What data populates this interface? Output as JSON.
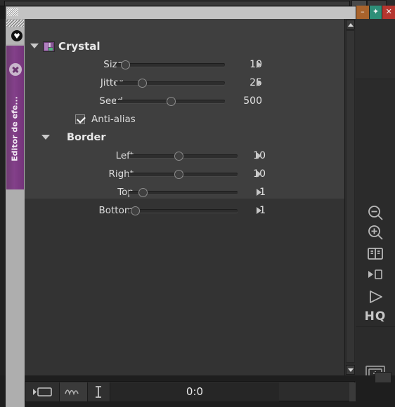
{
  "window": {
    "controls": [
      {
        "name": "minimize",
        "glyph": "–",
        "color": "#a9632c"
      },
      {
        "name": "maximize",
        "glyph": "✦",
        "color": "#2e8f78"
      },
      {
        "name": "close",
        "glyph": "✕",
        "color": "#b5362f"
      }
    ]
  },
  "left_rail": {
    "tab_label": "Editor de efe...",
    "tab_color": "#83408a",
    "close_icon": "close-circle-icon",
    "badge_icon": "shape-icon"
  },
  "effect": {
    "icon": "effect-thumbnail-icon",
    "title": "Crystal",
    "expanded": true,
    "parameters": [
      {
        "label": "Size",
        "value": "10",
        "knob_pct": 8,
        "has_keyframe_arrow": true
      },
      {
        "label": "Jitter",
        "value": "25",
        "knob_pct": 24,
        "has_keyframe_arrow": true
      },
      {
        "label": "Seed",
        "value": "500",
        "knob_pct": 50,
        "has_keyframe_arrow": false
      }
    ],
    "checkbox": {
      "label": "Anti-alias",
      "checked": true
    },
    "group": {
      "title": "Border",
      "expanded": true,
      "parameters": [
        {
          "label": "Left",
          "value": "10",
          "knob_pct": 46,
          "has_keyframe_arrow": true
        },
        {
          "label": "Right",
          "value": "10",
          "knob_pct": 46,
          "has_keyframe_arrow": true
        },
        {
          "label": "Top",
          "value": "1",
          "knob_pct": 8,
          "has_keyframe_arrow": true
        },
        {
          "label": "Bottom",
          "value": "1",
          "knob_pct": 2,
          "has_keyframe_arrow": true
        }
      ]
    }
  },
  "scrollbar": {
    "up_arrow": "scroll-up-arrow-icon",
    "down_arrow": "scroll-down-arrow-icon"
  },
  "right_toolbar": {
    "items": [
      {
        "name": "zoom-out-icon",
        "label": ""
      },
      {
        "name": "zoom-in-icon",
        "label": ""
      },
      {
        "name": "split-view-icon",
        "label": ""
      },
      {
        "name": "step-forward-icon",
        "label": ""
      },
      {
        "name": "play-icon",
        "label": ""
      },
      {
        "name": "hq-toggle",
        "label": "HQ"
      },
      {
        "name": "preview-monitor-icon",
        "label": ""
      }
    ]
  },
  "bottom_bar": {
    "buttons": [
      {
        "name": "clip-view-icon"
      },
      {
        "name": "waveform-icon"
      },
      {
        "name": "text-cursor-icon"
      }
    ],
    "timecode": "0:0"
  }
}
